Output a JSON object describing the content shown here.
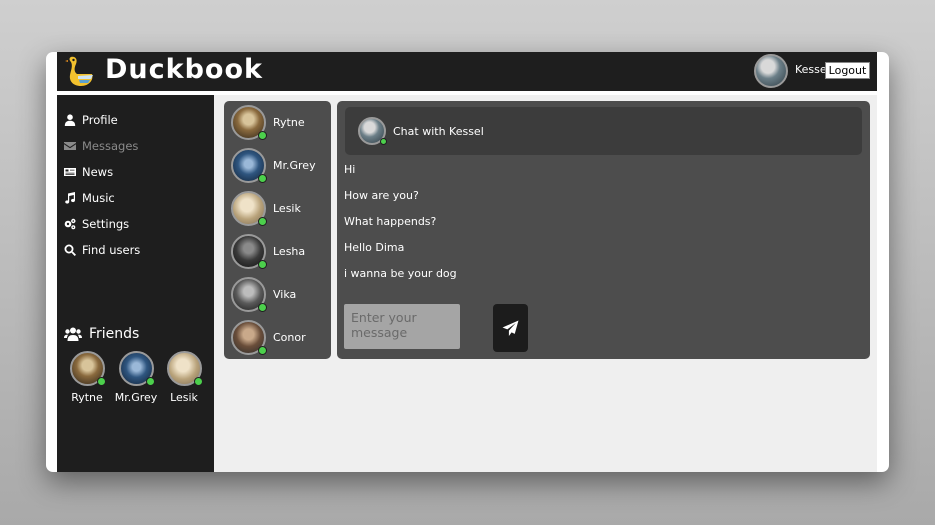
{
  "header": {
    "brand": "Duckbook",
    "user_name": "Kessel",
    "logout_label": "Logout"
  },
  "sidebar": {
    "nav": [
      {
        "label": "Profile",
        "icon": "user-icon",
        "active": false
      },
      {
        "label": "Messages",
        "icon": "envelope-icon",
        "active": true
      },
      {
        "label": "News",
        "icon": "newspaper-icon",
        "active": false
      },
      {
        "label": "Music",
        "icon": "music-note-icon",
        "active": false
      },
      {
        "label": "Settings",
        "icon": "gears-icon",
        "active": false
      },
      {
        "label": "Find users",
        "icon": "search-icon",
        "active": false
      }
    ],
    "friends_title": "Friends",
    "friends": [
      {
        "name": "Rytne",
        "online": true
      },
      {
        "name": "Mr.Grey",
        "online": true
      },
      {
        "name": "Lesik",
        "online": true
      }
    ]
  },
  "dialogs": [
    {
      "name": "Rytne",
      "online": true
    },
    {
      "name": "Mr.Grey",
      "online": true
    },
    {
      "name": "Lesik",
      "online": true
    },
    {
      "name": "Lesha",
      "online": true
    },
    {
      "name": "Vika",
      "online": true
    },
    {
      "name": "Conor",
      "online": true
    }
  ],
  "chat": {
    "title": "Chat with Kessel",
    "messages": [
      "Hi",
      "How are you?",
      "What happends?",
      "Hello Dima",
      "i wanna be your dog"
    ],
    "input_placeholder": "Enter your message"
  },
  "colors": {
    "header_bg": "#1e1e1e",
    "panel_bg": "#4d4d4d",
    "online": "#4cd04c",
    "logo_yellow": "#f2c12e"
  }
}
